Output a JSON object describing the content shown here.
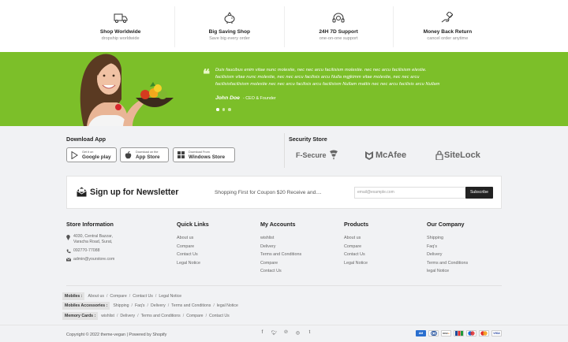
{
  "features": [
    {
      "icon": "truck-icon",
      "title": "Shop Worldwide",
      "subtitle": "dropship worldwide"
    },
    {
      "icon": "piggy-bank-icon",
      "title": "Big Saving Shop",
      "subtitle": "Save big every order"
    },
    {
      "icon": "headset-icon",
      "title": "24H 7D Support",
      "subtitle": "one-on-one support"
    },
    {
      "icon": "money-hand-icon",
      "title": "Money Back Return",
      "subtitle": "cancel order anytime"
    }
  ],
  "testimonial": {
    "quote_lines": [
      "Duis faucibus enim vitae nunc molestie, nec nec arcu facilisism molestie. nec nec arcu facilisism elestie.",
      "facilisism vitae nunc molestie, nec nec arcu facilisis arcu Nulla mgjkimm vitae molestie, nec nec arcu",
      "facilisisfacilisism molestie nec nec arcu facilisis arcu facilisism Nullam mattis nec nec arcu facilisis arcu Nullam"
    ],
    "author": "John Doe",
    "role": "- CEO & Founder",
    "background": "#7cbf29"
  },
  "download_app": {
    "title": "Download App",
    "buttons": [
      {
        "icon": "google-play-icon",
        "small": "Get it on",
        "big": "Google play"
      },
      {
        "icon": "apple-icon",
        "small": "Download on the",
        "big": "App Store"
      },
      {
        "icon": "windows-icon",
        "small": "Download From",
        "big": "Windows Store"
      }
    ]
  },
  "security": {
    "title": "Security Store",
    "logos": [
      "F-Secure",
      "McAfee",
      "SiteLock"
    ]
  },
  "newsletter": {
    "title": "Sign up for Newsletter",
    "text": "Shopping First for Coupon $20 Receive and....",
    "placeholder": "email@example.com",
    "button": "Subscribe"
  },
  "store_info": {
    "title": "Store Information",
    "address_line1": "4030, Central Bazzar,",
    "address_line2": "Varacha Road, Surat,",
    "phone": "092770-77088",
    "email": "admin@yourstore.com"
  },
  "columns": [
    {
      "title": "Quick Links",
      "links": [
        "About us",
        "Compare",
        "Contact Us",
        "Legal Notice"
      ]
    },
    {
      "title": "My Accounts",
      "links": [
        "wishlist",
        "Delivery",
        "Terms and Conditions",
        "Compare",
        "Contact Us"
      ]
    },
    {
      "title": "Products",
      "links": [
        "About us",
        "Compare",
        "Contact Us",
        "Legal Notice"
      ]
    },
    {
      "title": "Our Company",
      "links": [
        "Shipping",
        "Faq's",
        "Delivery",
        "Terms and Conditions",
        "legal Notice"
      ]
    }
  ],
  "tag_rows": [
    {
      "label": "Mobiles :",
      "links": [
        "About us",
        "Compare",
        "Contact Us",
        "Legal Notice"
      ]
    },
    {
      "label": "Mobiles Accessories :",
      "links": [
        "Shipping",
        "Faq's",
        "Delivery",
        "Terms and Conditions",
        "legal Notice"
      ]
    },
    {
      "label": "Memory Cards :",
      "links": [
        "wishlist",
        "Delivery",
        "Terms and Conditions",
        "Compare",
        "Contact Us"
      ]
    }
  ],
  "copyright": "Copyright © 2022 theme-vegan | Powered by Shopify",
  "social": [
    "facebook-icon",
    "twitter-icon",
    "pinterest-icon",
    "instagram-icon",
    "tumblr-icon"
  ],
  "payments": [
    {
      "name": "amex-icon",
      "color": "#2a6fcf"
    },
    {
      "name": "diners-icon",
      "color": "#ffffff"
    },
    {
      "name": "discover-icon",
      "color": "#ffffff"
    },
    {
      "name": "jcb-icon",
      "color": "#ffffff"
    },
    {
      "name": "maestro-icon",
      "color": "#ffffff"
    },
    {
      "name": "mastercard-icon",
      "color": "#ffffff"
    },
    {
      "name": "visa-icon",
      "color": "#ffffff"
    }
  ]
}
